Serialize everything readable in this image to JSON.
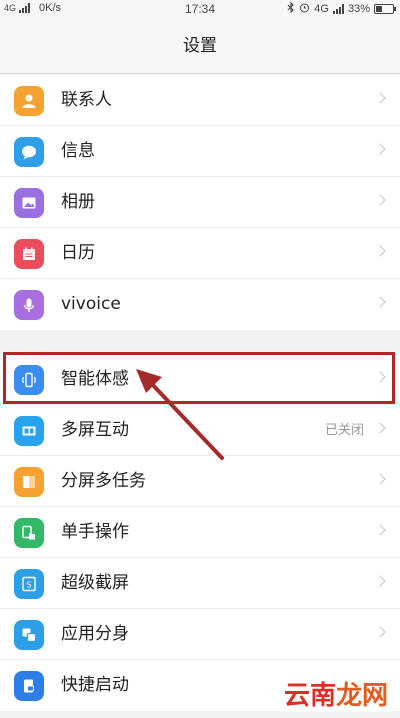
{
  "status_bar": {
    "network": "4G",
    "speed": "0K/s",
    "time": "17:34",
    "right_network": "4G",
    "battery": "33%",
    "battery_level": 0.33
  },
  "title": "设置",
  "group1": [
    {
      "label": "联系人",
      "icon": "contacts-icon",
      "color": "#f4a232"
    },
    {
      "label": "信息",
      "icon": "messages-icon",
      "color": "#2e9fe8"
    },
    {
      "label": "相册",
      "icon": "album-icon",
      "color": "#9a6fe0"
    },
    {
      "label": "日历",
      "icon": "calendar-icon",
      "color": "#ec4d5c"
    },
    {
      "label": "vivoice",
      "icon": "microphone-icon",
      "color": "#a96ee0"
    }
  ],
  "group2": [
    {
      "label": "智能体感",
      "icon": "smart-motion-icon",
      "color": "#3b8ef0",
      "value": ""
    },
    {
      "label": "多屏互动",
      "icon": "multi-screen-icon",
      "color": "#2aa3ee",
      "value": "已关闭"
    },
    {
      "label": "分屏多任务",
      "icon": "split-screen-icon",
      "color": "#f5a233",
      "value": ""
    },
    {
      "label": "单手操作",
      "icon": "one-hand-icon",
      "color": "#33b86a",
      "value": ""
    },
    {
      "label": "超级截屏",
      "icon": "screenshot-icon",
      "color": "#2c9fe6",
      "value": ""
    },
    {
      "label": "应用分身",
      "icon": "app-clone-icon",
      "color": "#2c9fe6",
      "value": ""
    },
    {
      "label": "快捷启动",
      "icon": "quick-launch-icon",
      "color": "#2c7fe6",
      "value": ""
    }
  ],
  "watermark": {
    "part1": "云南",
    "part2": "龙网"
  }
}
